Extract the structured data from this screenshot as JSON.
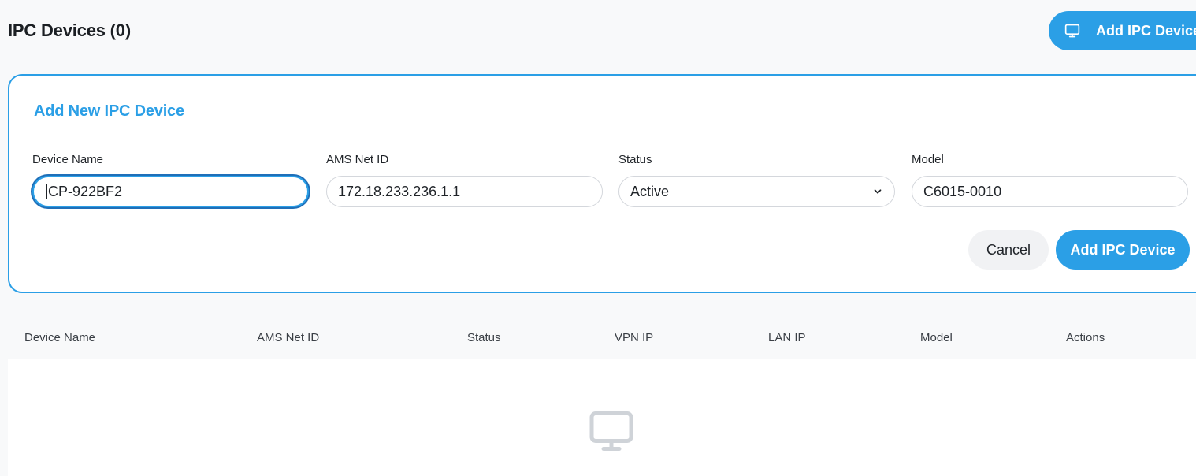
{
  "header": {
    "title": "IPC Devices (0)",
    "add_button_label": "Add IPC Device",
    "add_button_icon": "monitor-icon"
  },
  "form": {
    "title": "Add New IPC Device",
    "fields": {
      "device_name": {
        "label": "Device Name",
        "value": "CP-922BF2"
      },
      "ams_net_id": {
        "label": "AMS Net ID",
        "value": "172.18.233.236.1.1"
      },
      "status": {
        "label": "Status",
        "value": "Active"
      },
      "model": {
        "label": "Model",
        "value": "C6015-0010"
      }
    },
    "cancel_label": "Cancel",
    "submit_label": "Add IPC Device"
  },
  "table": {
    "columns": [
      "Device Name",
      "AMS Net ID",
      "Status",
      "VPN IP",
      "LAN IP",
      "Model",
      "Actions"
    ],
    "rows": [],
    "empty_icon": "monitor-icon"
  },
  "colors": {
    "accent": "#2b9fe6",
    "background": "#f8f9fa",
    "text": "#1f2328"
  }
}
